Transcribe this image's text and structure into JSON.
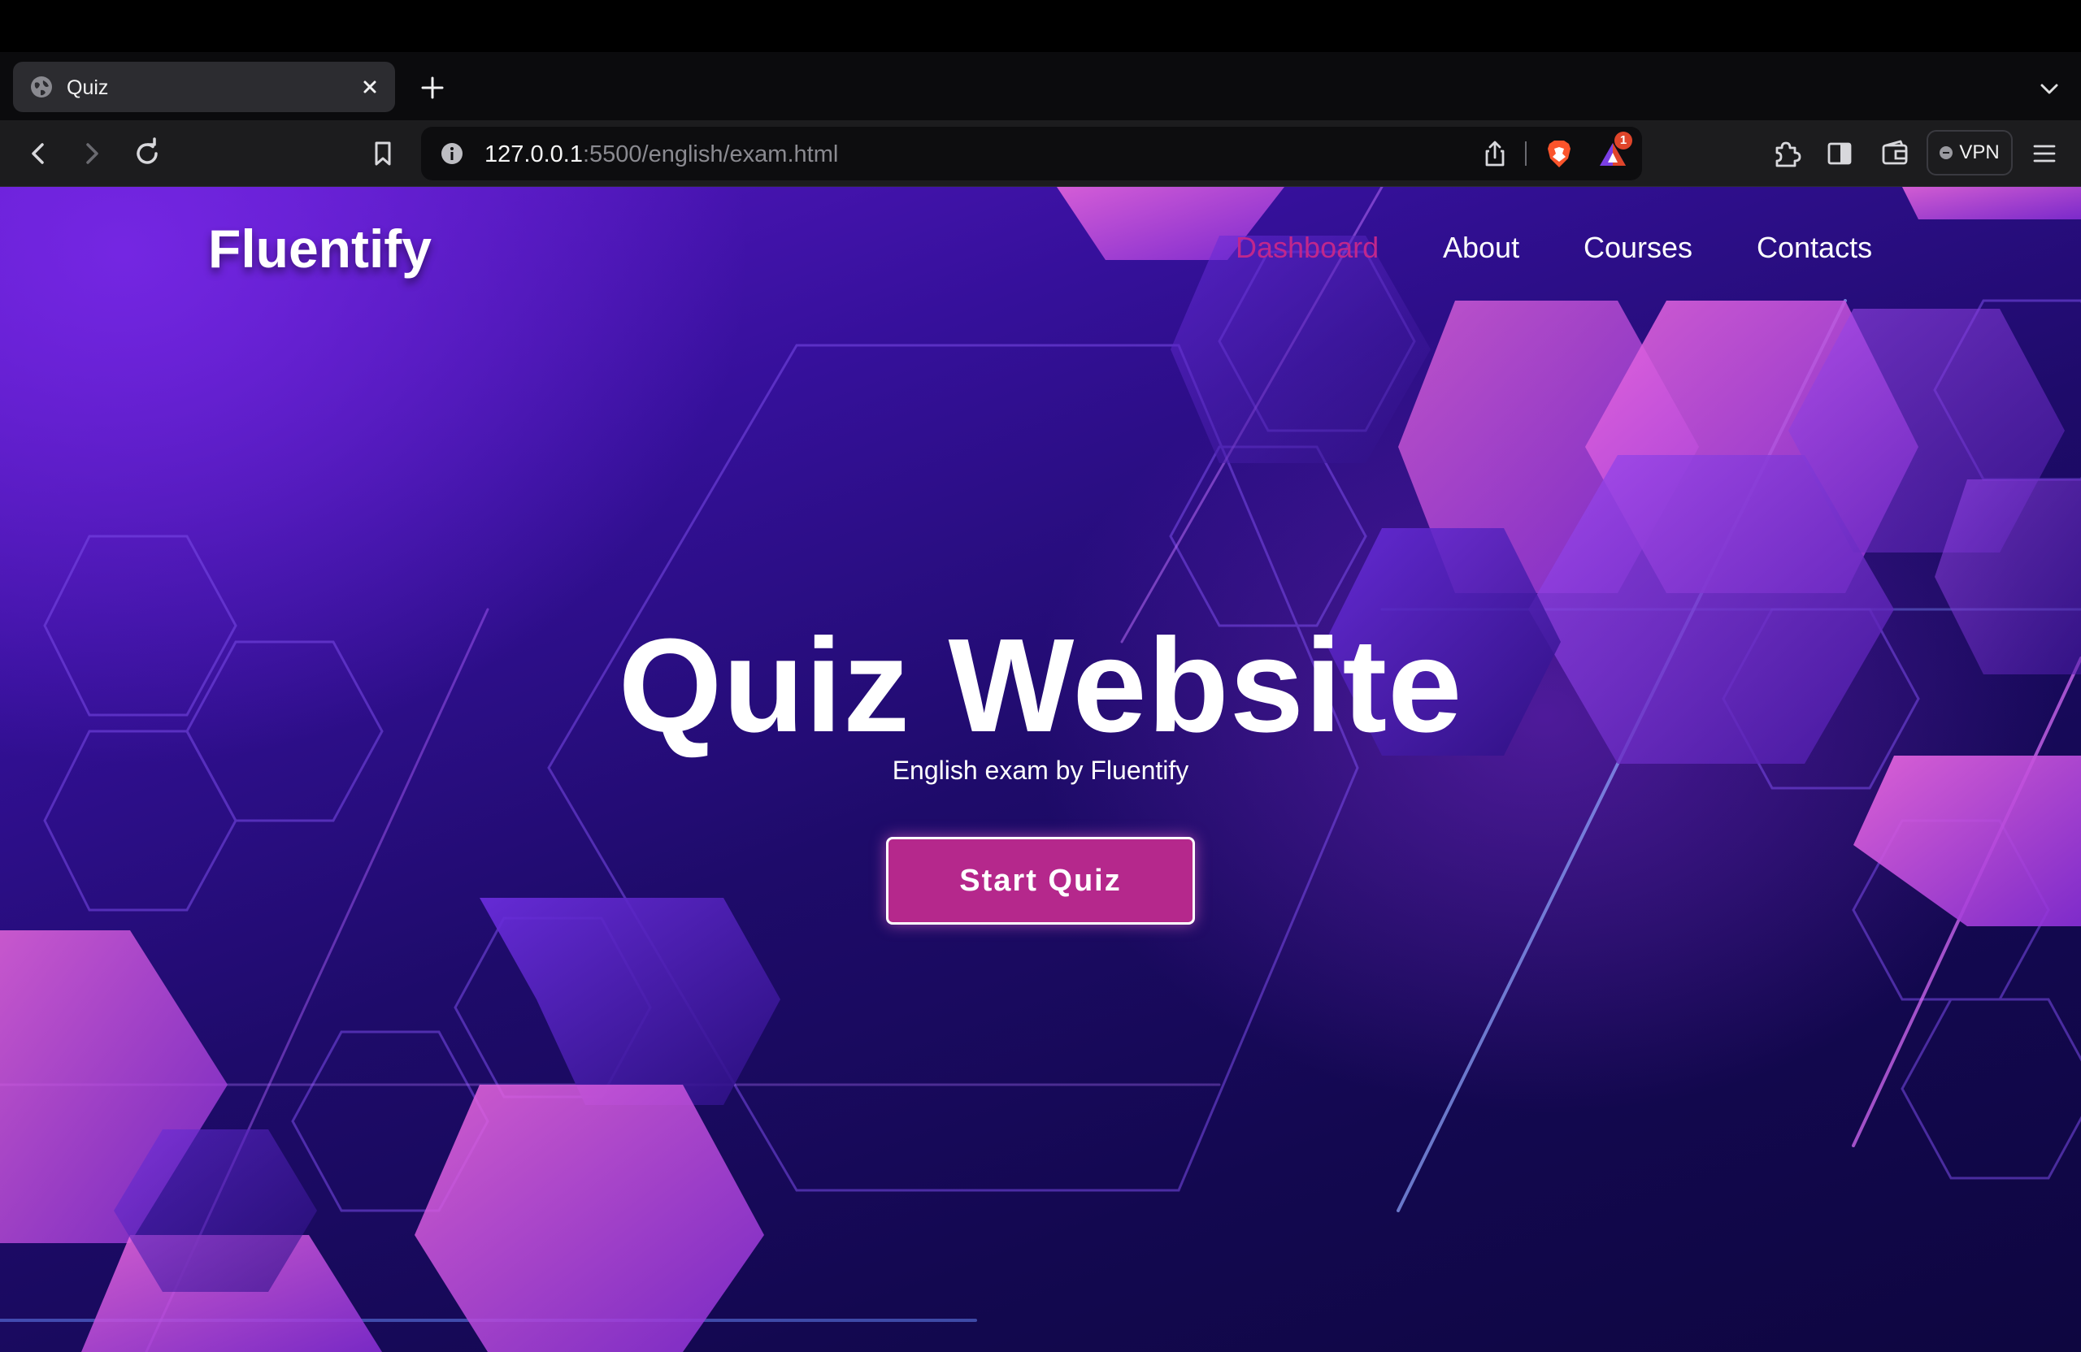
{
  "browser": {
    "tab": {
      "title": "Quiz",
      "icon": "globe-icon"
    },
    "url": {
      "host": "127.0.0.1",
      "path": ":5500/english/exam.html"
    },
    "rewards_badge": "1",
    "vpn_label": "VPN",
    "accent_color": "#e0452a"
  },
  "site": {
    "brand": "Fluentify",
    "nav": [
      {
        "label": "Dashboard",
        "active": true
      },
      {
        "label": "About",
        "active": false
      },
      {
        "label": "Courses",
        "active": false
      },
      {
        "label": "Contacts",
        "active": false
      }
    ],
    "hero": {
      "title": "Quiz Website",
      "subtitle": "English exam by Fluentify",
      "cta": "Start Quiz"
    },
    "colors": {
      "active_nav": "#c1278c",
      "cta_bg": "#b5288c",
      "bg_top": "#5a18c8",
      "bg_bottom": "#0e0640"
    }
  }
}
